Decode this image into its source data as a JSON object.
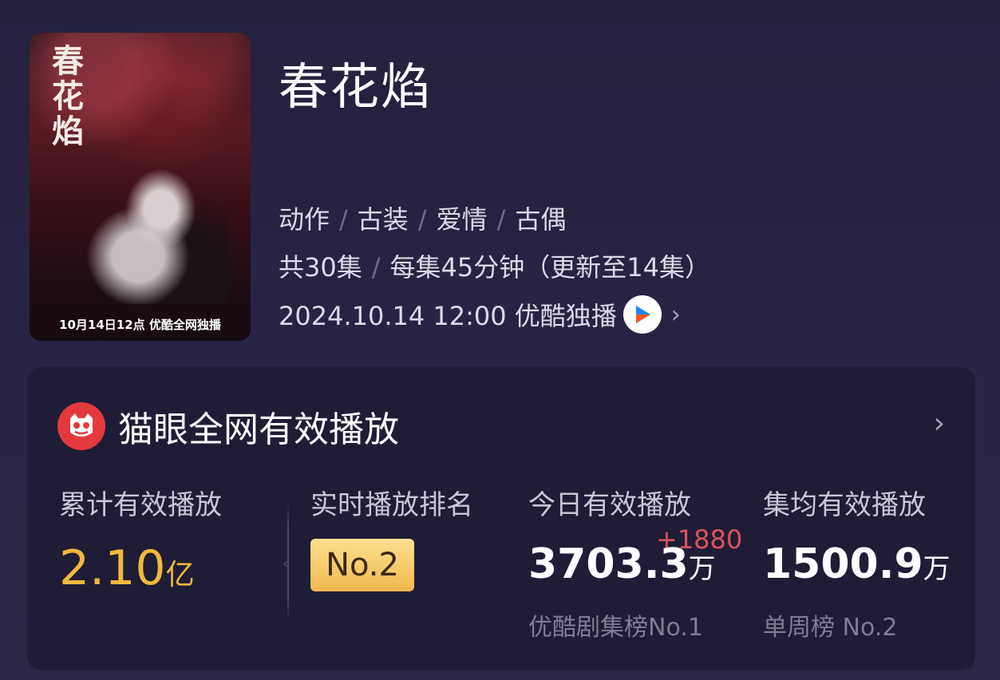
{
  "poster": {
    "title": "春花焰",
    "caption": "10月14日12点 优酷全网独播"
  },
  "show": {
    "title": "春花焰",
    "genres": [
      "动作",
      "古装",
      "爱情",
      "古偶"
    ],
    "episodes_total": "共30集",
    "episode_detail": "每集45分钟（更新至14集）",
    "release": "2024.10.14 12:00 优酷独播",
    "platform_icon": "youku-icon"
  },
  "stats_card": {
    "title": "猫眼全网有效播放",
    "logo_icon": "maoyan-cat-icon",
    "cumulative": {
      "label": "累计有效播放",
      "value": "2.10",
      "unit": "亿"
    },
    "rank": {
      "label": "实时播放排名",
      "value": "No.2"
    },
    "today": {
      "label": "今日有效播放",
      "value": "3703.3",
      "unit": "万",
      "delta": "+1880",
      "sub": "优酷剧集榜No.1"
    },
    "average": {
      "label": "集均有效播放",
      "value": "1500.9",
      "unit": "万",
      "sub": "单周榜 No.2"
    }
  },
  "colors": {
    "background": "#25223f",
    "card": "#1f1d36",
    "accent_gold": "#f3b83a",
    "delta_red": "#e0505c",
    "maoyan_red": "#e4393c"
  }
}
